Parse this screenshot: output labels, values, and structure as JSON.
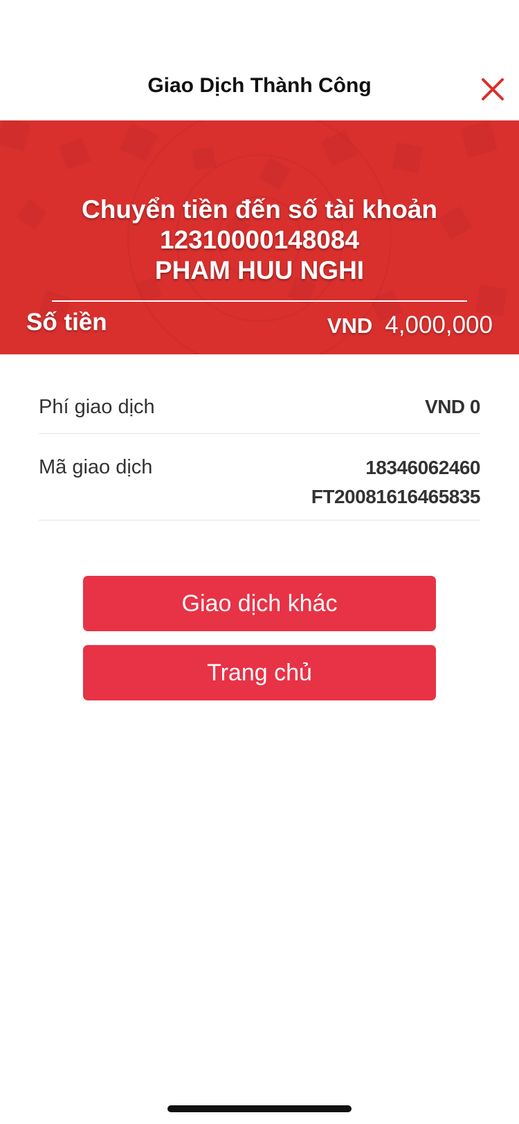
{
  "header": {
    "title": "Giao Dịch Thành Công",
    "close_icon": "close-icon"
  },
  "banner": {
    "line1": "Chuyển tiền đến số tài khoản",
    "account_number": "12310000148084",
    "account_name": "PHAM HUU NGHI",
    "amount_label": "Số tiền",
    "amount_currency": "VND",
    "amount_value": "4,000,000"
  },
  "details": {
    "fee_label": "Phí giao dịch",
    "fee_value": "VND 0",
    "ref_label": "Mã giao dịch",
    "ref_value_1": "18346062460",
    "ref_value_2": "FT20081616465835"
  },
  "buttons": {
    "other_transaction": "Giao dịch khác",
    "home": "Trang chủ"
  },
  "colors": {
    "banner": "#d9302e",
    "button": "#e83246",
    "close": "#d9302e"
  }
}
